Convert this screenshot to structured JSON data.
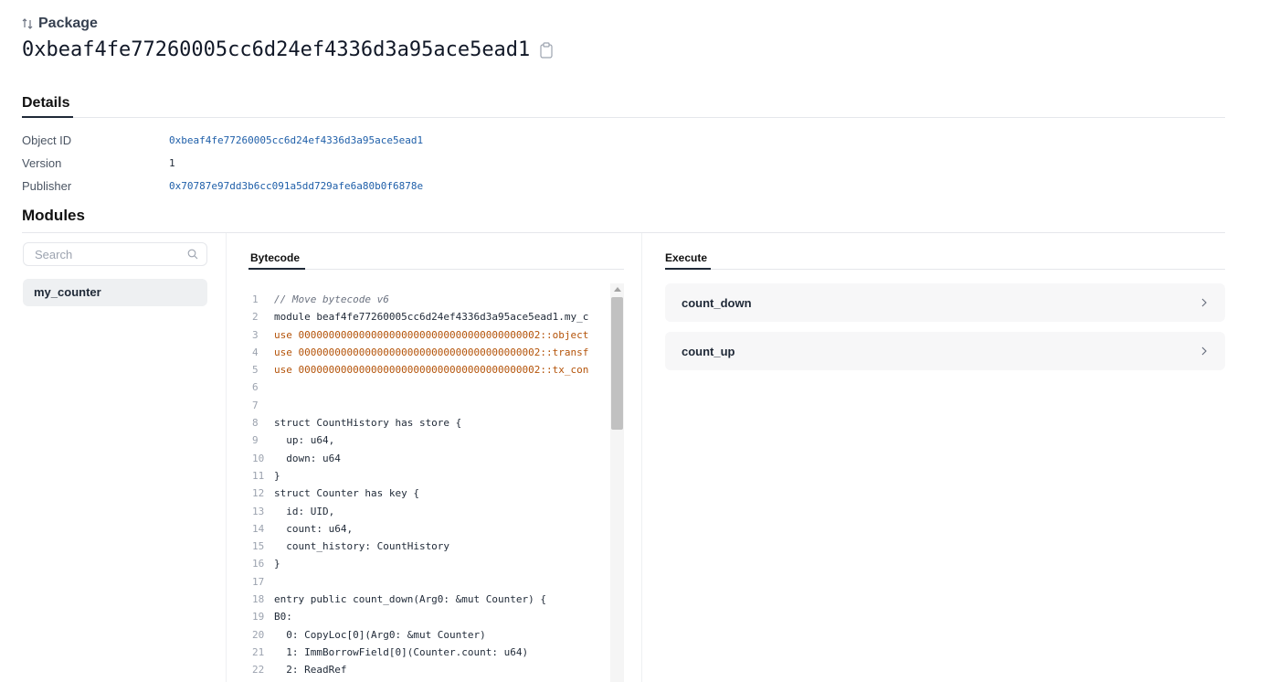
{
  "header": {
    "kind_label": "Package",
    "package_id": "0xbeaf4fe77260005cc6d24ef4336d3a95ace5ead1"
  },
  "details": {
    "title": "Details",
    "rows": [
      {
        "label": "Object ID",
        "value": "0xbeaf4fe77260005cc6d24ef4336d3a95ace5ead1"
      },
      {
        "label": "Version",
        "value": "1"
      },
      {
        "label": "Publisher",
        "value": "0x70787e97dd3b6cc091a5dd729afe6a80b0f6878e"
      }
    ]
  },
  "modules": {
    "title": "Modules",
    "search_placeholder": "Search",
    "items": [
      {
        "label": "my_counter"
      }
    ]
  },
  "bytecode": {
    "title": "Bytecode",
    "lines": [
      {
        "n": "1",
        "t": "// Move bytecode v6"
      },
      {
        "n": "2",
        "t": "module beaf4fe77260005cc6d24ef4336d3a95ace5ead1.my_c"
      },
      {
        "n": "3",
        "t": "use 0000000000000000000000000000000000000002::object"
      },
      {
        "n": "4",
        "t": "use 0000000000000000000000000000000000000002::transf"
      },
      {
        "n": "5",
        "t": "use 0000000000000000000000000000000000000002::tx_con"
      },
      {
        "n": "6",
        "t": ""
      },
      {
        "n": "7",
        "t": ""
      },
      {
        "n": "8",
        "t": "struct CountHistory has store {"
      },
      {
        "n": "9",
        "t": "  up: u64,"
      },
      {
        "n": "10",
        "t": "  down: u64"
      },
      {
        "n": "11",
        "t": "}"
      },
      {
        "n": "12",
        "t": "struct Counter has key {"
      },
      {
        "n": "13",
        "t": "  id: UID,"
      },
      {
        "n": "14",
        "t": "  count: u64,"
      },
      {
        "n": "15",
        "t": "  count_history: CountHistory"
      },
      {
        "n": "16",
        "t": "}"
      },
      {
        "n": "17",
        "t": ""
      },
      {
        "n": "18",
        "t": "entry public count_down(Arg0: &mut Counter) {"
      },
      {
        "n": "19",
        "t": "B0:"
      },
      {
        "n": "20",
        "t": "  0: CopyLoc[0](Arg0: &mut Counter)"
      },
      {
        "n": "21",
        "t": "  1: ImmBorrowField[0](Counter.count: u64)"
      },
      {
        "n": "22",
        "t": "  2: ReadRef"
      }
    ]
  },
  "execute": {
    "title": "Execute",
    "functions": [
      {
        "label": "count_down"
      },
      {
        "label": "count_up"
      }
    ]
  },
  "colors": {
    "link": "#1f5fa9",
    "accent_underline": "#1f2937",
    "card_bg": "#f7f7f8",
    "selected_bg": "#eef0f2"
  }
}
